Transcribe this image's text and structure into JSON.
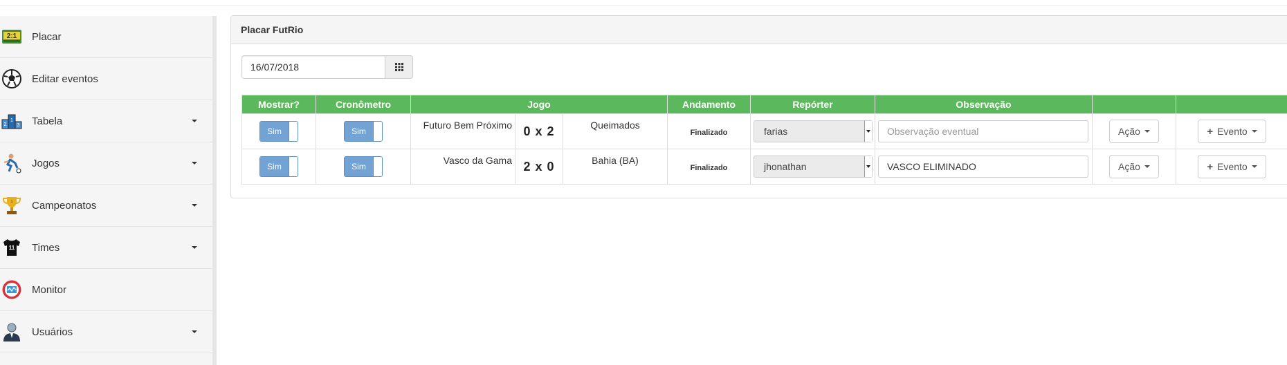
{
  "sidebar": {
    "items": [
      {
        "label": "Placar",
        "icon": "scoreboard-icon",
        "has_caret": false
      },
      {
        "label": "Editar eventos",
        "icon": "soccer-ball-icon",
        "has_caret": false
      },
      {
        "label": "Tabela",
        "icon": "podium-icon",
        "has_caret": true
      },
      {
        "label": "Jogos",
        "icon": "soccer-player-icon",
        "has_caret": true
      },
      {
        "label": "Campeonatos",
        "icon": "trophy-icon",
        "has_caret": true
      },
      {
        "label": "Times",
        "icon": "jersey-icon",
        "has_caret": true
      },
      {
        "label": "Monitor",
        "icon": "monitor-icon",
        "has_caret": false
      },
      {
        "label": "Usuários",
        "icon": "user-icon",
        "has_caret": true
      }
    ]
  },
  "panel": {
    "title": "Placar FutRio",
    "date": "16/07/2018"
  },
  "table": {
    "headers": [
      "Mostrar?",
      "Cronômetro",
      "Jogo",
      "Andamento",
      "Repórter",
      "Observação",
      "",
      ""
    ],
    "rows": [
      {
        "mostrar": "Sim",
        "cronometro": "Sim",
        "home": "Futuro Bem Próximo",
        "score": "0 x 2",
        "away": "Queimados",
        "status": "Finalizado",
        "reporter": "farias",
        "obs_value": "",
        "obs_placeholder": "Observação eventual",
        "acao": "Ação",
        "evento": "Evento"
      },
      {
        "mostrar": "Sim",
        "cronometro": "Sim",
        "home": "Vasco da Gama",
        "score": "2 x 0",
        "away": "Bahia (BA)",
        "status": "Finalizado",
        "reporter": "jhonathan",
        "obs_value": "VASCO ELIMINADO",
        "obs_placeholder": "Observação eventual",
        "acao": "Ação",
        "evento": "Evento"
      }
    ]
  },
  "colors": {
    "header_green": "#5cb85c",
    "toggle_blue": "#73a3d4"
  }
}
